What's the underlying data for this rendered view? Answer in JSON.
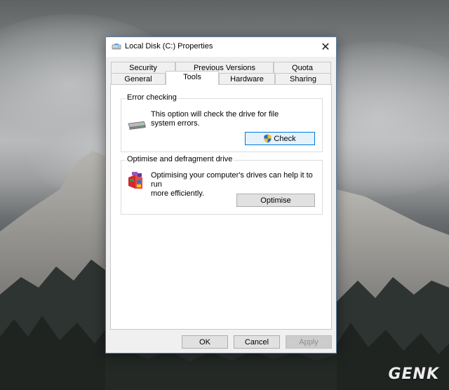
{
  "window": {
    "title": "Local Disk (C:) Properties",
    "close_glyph": "✕"
  },
  "tabs": {
    "row1": [
      {
        "label": "Security"
      },
      {
        "label": "Previous Versions"
      },
      {
        "label": "Quota"
      }
    ],
    "row2": [
      {
        "label": "General"
      },
      {
        "label": "Tools",
        "active": true
      },
      {
        "label": "Hardware"
      },
      {
        "label": "Sharing"
      }
    ]
  },
  "error_checking": {
    "title": "Error checking",
    "description_line1": "This option will check the drive for file",
    "description_line2": "system errors.",
    "button_label": "Check",
    "icon": "hard-drive-icon"
  },
  "optimise": {
    "title": "Optimise and defragment drive",
    "description_line1": "Optimising your computer's drives can help it to run",
    "description_line2": "more efficiently.",
    "button_label": "Optimise",
    "icon": "defrag-icon"
  },
  "footer": {
    "ok_label": "OK",
    "cancel_label": "Cancel",
    "apply_label": "Apply"
  },
  "watermark": {
    "text": "GENK"
  },
  "colors": {
    "accent": "#0078d7",
    "shield_blue": "#2b67c7",
    "shield_yellow": "#f2c21b"
  }
}
